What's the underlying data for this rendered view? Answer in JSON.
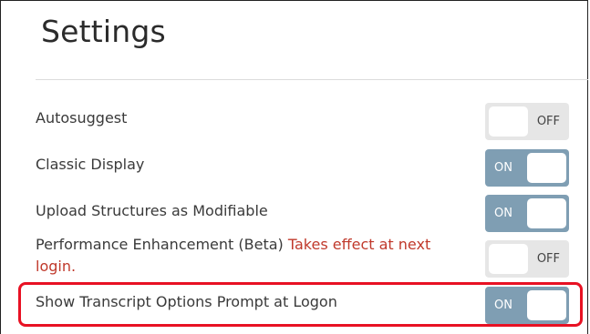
{
  "page": {
    "title": "Settings"
  },
  "settings": [
    {
      "label": "Autosuggest",
      "state": "OFF"
    },
    {
      "label": "Classic Display",
      "state": "ON"
    },
    {
      "label": "Upload Structures as Modifiable",
      "state": "ON"
    },
    {
      "label": "Performance Enhancement (Beta)",
      "note": "Takes effect at next login.",
      "state": "OFF"
    },
    {
      "label": "Show Transcript Options Prompt at Logon",
      "state": "ON"
    }
  ],
  "colors": {
    "toggle_on": "#7f9eb3",
    "toggle_off": "#e6e6e6",
    "warning_text": "#c0392b",
    "highlight_border": "#e81123"
  }
}
